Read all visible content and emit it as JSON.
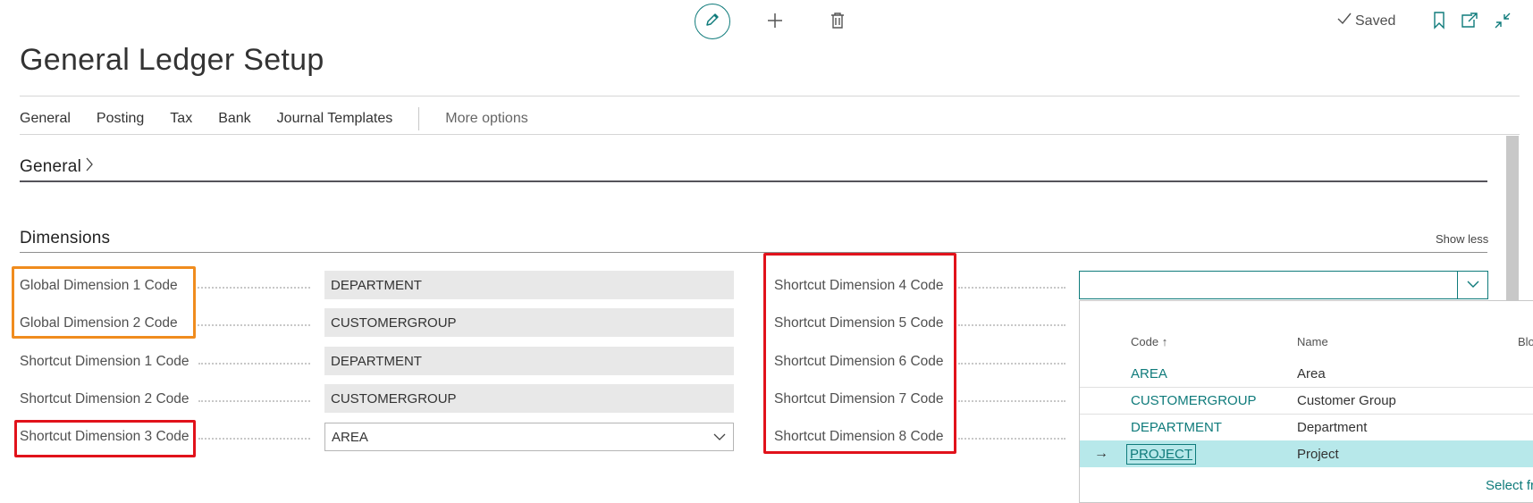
{
  "header": {
    "title": "General Ledger Setup",
    "status": "Saved"
  },
  "tabs": [
    "General",
    "Posting",
    "Tax",
    "Bank",
    "Journal Templates"
  ],
  "more_options": "More options",
  "sections": {
    "general": "General",
    "dimensions": "Dimensions",
    "show_less": "Show less"
  },
  "left_fields": [
    {
      "label": "Global Dimension 1 Code",
      "value": "DEPARTMENT"
    },
    {
      "label": "Global Dimension 2 Code",
      "value": "CUSTOMERGROUP"
    },
    {
      "label": "Shortcut Dimension 1 Code",
      "value": "DEPARTMENT"
    },
    {
      "label": "Shortcut Dimension 2 Code",
      "value": "CUSTOMERGROUP"
    },
    {
      "label": "Shortcut Dimension 3 Code",
      "value": "AREA"
    }
  ],
  "right_fields": [
    {
      "label": "Shortcut Dimension 4 Code",
      "value": ""
    },
    {
      "label": "Shortcut Dimension 5 Code"
    },
    {
      "label": "Shortcut Dimension 6 Code"
    },
    {
      "label": "Shortcut Dimension 7 Code"
    },
    {
      "label": "Shortcut Dimension 8 Code"
    }
  ],
  "lookup": {
    "columns": {
      "code": "Code",
      "code_sort": "↑",
      "name": "Name",
      "blocked_partial": "Blo"
    },
    "rows": [
      {
        "code": "AREA",
        "name": "Area"
      },
      {
        "code": "CUSTOMERGROUP",
        "name": "Customer Group"
      },
      {
        "code": "DEPARTMENT",
        "name": "Department"
      },
      {
        "code": "PROJECT",
        "name": "Project"
      }
    ],
    "selected_arrow": "→",
    "select_from_partial": "Select fr"
  },
  "colors": {
    "accent": "#0f7b7b",
    "highlight_orange": "#f08c1e",
    "highlight_red": "#e1121b",
    "selected_row": "#b7e8ea"
  }
}
